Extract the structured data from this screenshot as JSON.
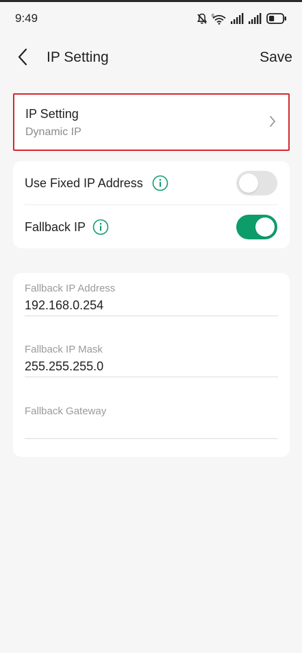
{
  "status_bar": {
    "time": "9:49",
    "battery_level": 0.4,
    "icons": [
      "bell-off-icon",
      "wifi-icon",
      "signal-icon",
      "signal-icon",
      "battery-icon"
    ]
  },
  "header": {
    "title": "IP Setting",
    "save_label": "Save",
    "back_icon": "chevron-left-icon"
  },
  "ip_setting": {
    "title": "IP Setting",
    "value": "Dynamic IP",
    "highlight_color": "#d6262f"
  },
  "toggles": [
    {
      "label": "Use Fixed IP Address",
      "on": false,
      "info_icon": "info-icon"
    },
    {
      "label": "Fallback IP",
      "on": true,
      "info_icon": "info-icon"
    }
  ],
  "fields": [
    {
      "label": "Fallback IP Address",
      "value": "192.168.0.254"
    },
    {
      "label": "Fallback IP Mask",
      "value": "255.255.255.0"
    },
    {
      "label": "Fallback Gateway",
      "value": ""
    }
  ],
  "colors": {
    "accent": "#0c9d6a",
    "background": "#f6f6f6",
    "card": "#ffffff"
  }
}
